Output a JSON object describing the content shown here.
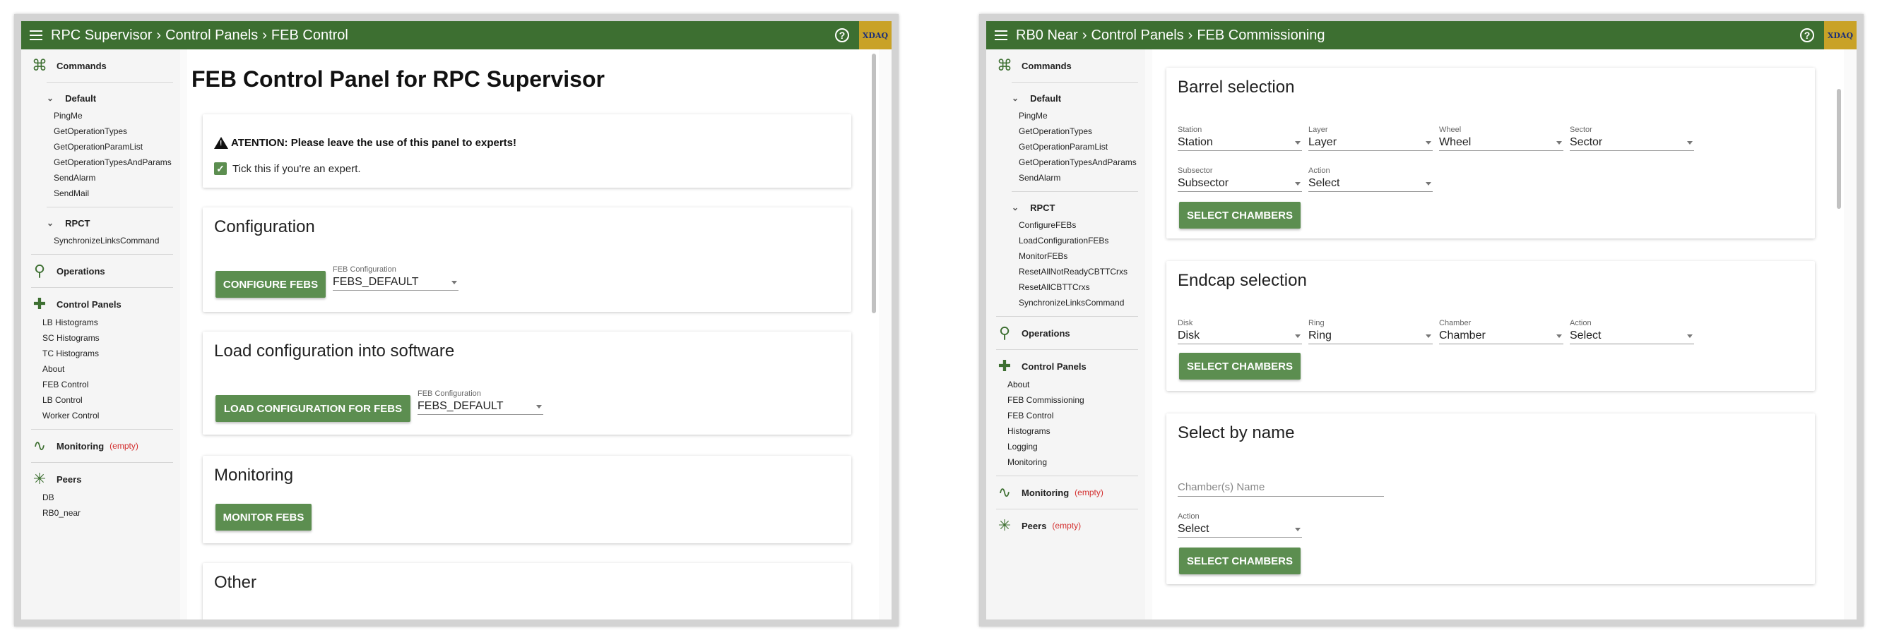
{
  "left_window": {
    "breadcrumb": [
      "RPC Supervisor",
      "Control Panels",
      "FEB Control"
    ],
    "help_icon": "?",
    "logo_text": "XDAQ",
    "sidebar": {
      "commands_label": "Commands",
      "default_group": "Default",
      "default_items": [
        "PingMe",
        "GetOperationTypes",
        "GetOperationParamList",
        "GetOperationTypesAndParams",
        "SendAlarm",
        "SendMail"
      ],
      "rpct_group": "RPCT",
      "rpct_items": [
        "SynchronizeLinksCommand"
      ],
      "operations_label": "Operations",
      "control_panels_label": "Control Panels",
      "control_panels_items": [
        "LB Histograms",
        "SC Histograms",
        "TC Histograms",
        "About",
        "FEB Control",
        "LB Control",
        "Worker Control"
      ],
      "monitoring_label": "Monitoring",
      "monitoring_empty": "(empty)",
      "peers_label": "Peers",
      "peers_items": [
        "DB",
        "RB0_near"
      ]
    },
    "main": {
      "title": "FEB Control Panel for RPC Supervisor",
      "attention_text": "ATENTION: Please leave the use of this panel to experts!",
      "expert_checkbox_label": "Tick this if you're an expert.",
      "expert_checked": true,
      "configuration": {
        "title": "Configuration",
        "button": "CONFIGURE FEBS",
        "field_label": "FEB Configuration",
        "field_value": "FEBS_DEFAULT"
      },
      "load": {
        "title": "Load configuration into software",
        "button": "LOAD CONFIGURATION FOR FEBS",
        "field_label": "FEB Configuration",
        "field_value": "FEBS_DEFAULT"
      },
      "monitoring": {
        "title": "Monitoring",
        "button": "MONITOR FEBS"
      },
      "other": {
        "title": "Other"
      }
    }
  },
  "right_window": {
    "breadcrumb": [
      "RB0 Near",
      "Control Panels",
      "FEB Commissioning"
    ],
    "help_icon": "?",
    "logo_text": "XDAQ",
    "sidebar": {
      "commands_label": "Commands",
      "default_group": "Default",
      "default_items": [
        "PingMe",
        "GetOperationTypes",
        "GetOperationParamList",
        "GetOperationTypesAndParams",
        "SendAlarm"
      ],
      "rpct_group": "RPCT",
      "rpct_items": [
        "ConfigureFEBs",
        "LoadConfigurationFEBs",
        "MonitorFEBs",
        "ResetAllNotReadyCBTTCrxs",
        "ResetAllCBTTCrxs",
        "SynchronizeLinksCommand"
      ],
      "operations_label": "Operations",
      "control_panels_label": "Control Panels",
      "control_panels_items": [
        "About",
        "FEB Commissioning",
        "FEB Control",
        "Histograms",
        "Logging",
        "Monitoring"
      ],
      "monitoring_label": "Monitoring",
      "monitoring_empty": "(empty)",
      "peers_label": "Peers",
      "peers_empty": "(empty)"
    },
    "main": {
      "barrel": {
        "title": "Barrel selection",
        "station_label": "Station",
        "station_value": "Station",
        "layer_label": "Layer",
        "layer_value": "Layer",
        "wheel_label": "Wheel",
        "wheel_value": "Wheel",
        "sector_label": "Sector",
        "sector_value": "Sector",
        "subsector_label": "Subsector",
        "subsector_value": "Subsector",
        "action_label": "Action",
        "action_value": "Select",
        "button": "SELECT CHAMBERS"
      },
      "endcap": {
        "title": "Endcap selection",
        "disk_label": "Disk",
        "disk_value": "Disk",
        "ring_label": "Ring",
        "ring_value": "Ring",
        "chamber_label": "Chamber",
        "chamber_value": "Chamber",
        "action_label": "Action",
        "action_value": "Select",
        "button": "SELECT CHAMBERS"
      },
      "by_name": {
        "title": "Select by name",
        "name_placeholder": "Chamber(s) Name",
        "action_label": "Action",
        "action_value": "Select",
        "button": "SELECT CHAMBERS"
      }
    }
  },
  "colors": {
    "topbar": "#3d6f31",
    "button": "#5c8e50",
    "empty_text": "#d32f2f"
  },
  "icons": {
    "menu": "hamburger-icon",
    "help": "help-circle-icon",
    "commands": "command-key-icon",
    "operations": "flow-icon",
    "control_panels": "puzzle-icon",
    "monitoring": "pulse-icon",
    "peers": "network-icon"
  }
}
